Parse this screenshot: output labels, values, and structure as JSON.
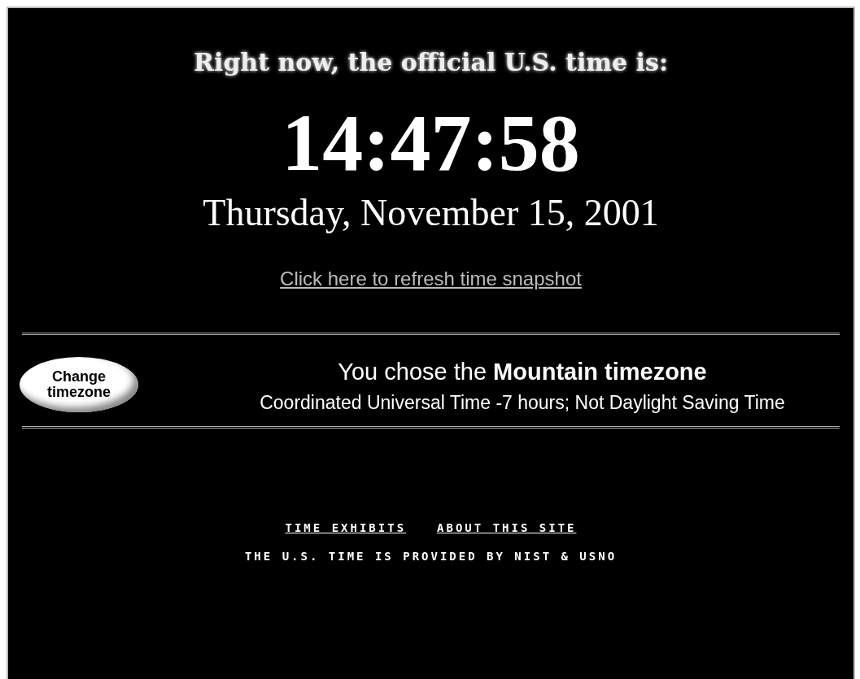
{
  "heading": "Right now, the official U.S. time is:",
  "time": "14:47:58",
  "date": "Thursday, November 15, 2001",
  "refresh_link": "Click here to refresh time snapshot",
  "timezone_button": "Change timezone",
  "timezone_title": "You chose the **Mountain timezone**",
  "timezone_detail": "Coordinated Universal Time -7 hours; Not Daylight Saving Time",
  "footer_links": [
    "TIME EXHIBITS",
    "ABOUT THIS SITE"
  ],
  "footer_note": "THE U.S. TIME IS PROVIDED BY NIST & USNO"
}
